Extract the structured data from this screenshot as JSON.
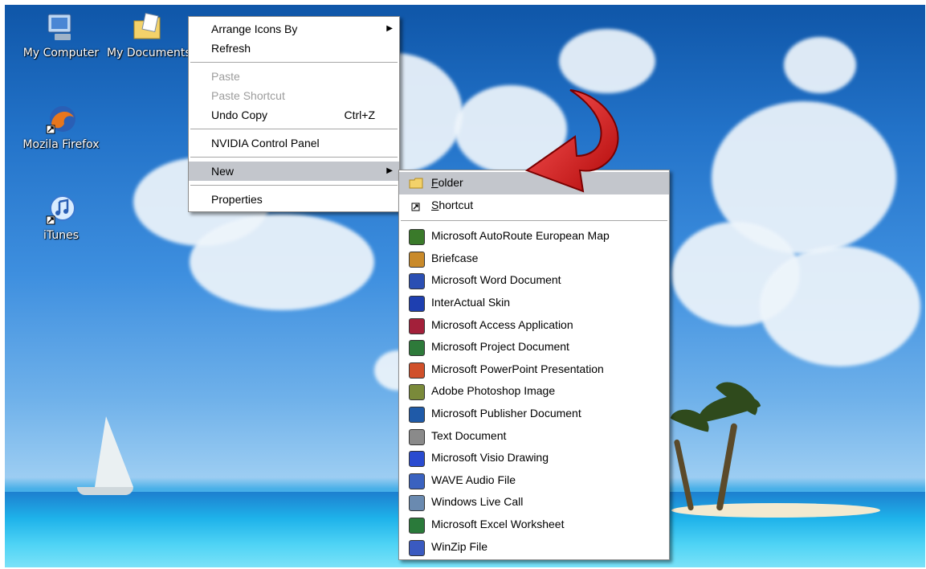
{
  "desktop": {
    "icons": [
      {
        "label": "My Computer",
        "icon": "my-computer-icon"
      },
      {
        "label": "My Documents",
        "icon": "my-documents-icon"
      },
      {
        "label": "Mozila Firefox",
        "icon": "firefox-icon"
      },
      {
        "label": "iTunes",
        "icon": "itunes-icon"
      }
    ]
  },
  "context_menu": {
    "items": [
      {
        "label": "Arrange Icons By"
      },
      {
        "label": "Refresh"
      },
      {
        "label": "Paste"
      },
      {
        "label": "Paste Shortcut"
      },
      {
        "label": "Undo Copy",
        "accelerator": "Ctrl+Z"
      },
      {
        "label": "NVIDIA Control Panel"
      },
      {
        "label": "New"
      },
      {
        "label": "Properties"
      }
    ]
  },
  "new_submenu": {
    "folder": {
      "first": "F",
      "rest": "older"
    },
    "shortcut": {
      "first": "S",
      "rest": "hortcut"
    },
    "items": [
      {
        "label": "Microsoft AutoRoute European Map",
        "color": "#3a7a2a"
      },
      {
        "label": "Briefcase",
        "color": "#c98a2a"
      },
      {
        "label": "Microsoft Word Document",
        "color": "#2b4fb3"
      },
      {
        "label": "InterActual Skin",
        "color": "#1e3fb0"
      },
      {
        "label": "Microsoft Access Application",
        "color": "#a3203a"
      },
      {
        "label": "Microsoft Project Document",
        "color": "#2e7a3a"
      },
      {
        "label": "Microsoft PowerPoint Presentation",
        "color": "#d0502a"
      },
      {
        "label": "Adobe Photoshop Image",
        "color": "#7a8a3a"
      },
      {
        "label": "Microsoft Publisher Document",
        "color": "#1f5aa8"
      },
      {
        "label": "Text Document",
        "color": "#8a8a8a"
      },
      {
        "label": "Microsoft Visio Drawing",
        "color": "#2a4bd0"
      },
      {
        "label": "WAVE Audio File",
        "color": "#3a62c0"
      },
      {
        "label": "Windows Live Call",
        "color": "#6a8ab0"
      },
      {
        "label": "Microsoft Excel Worksheet",
        "color": "#2a7a3a"
      },
      {
        "label": "WinZip File",
        "color": "#3a5ac0"
      }
    ]
  },
  "colors": {
    "highlight": "#c3c6cc",
    "disabled_text": "#9c9c9c",
    "arrow": "#d21a1a"
  }
}
